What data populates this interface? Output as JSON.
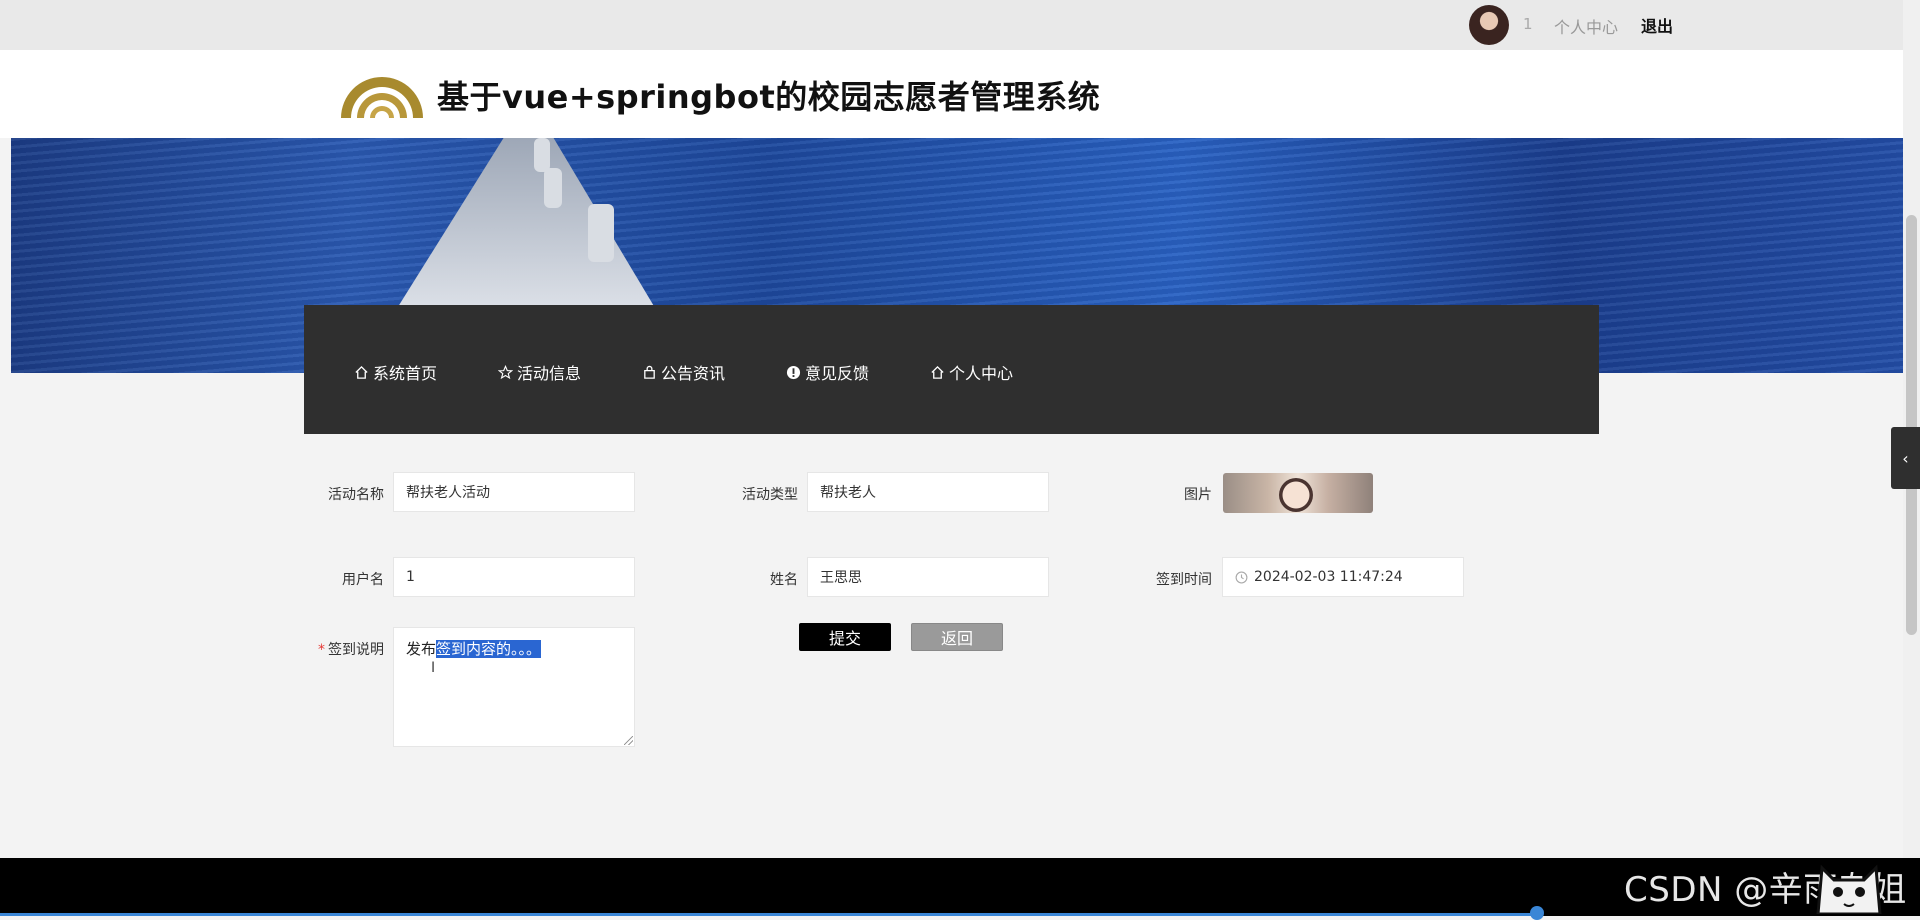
{
  "topbar": {
    "user_id": "1",
    "personal_center": "个人中心",
    "logout": "退出"
  },
  "header": {
    "title": "基于vue+springbot的校园志愿者管理系统",
    "logo_icon": "arch-logo-icon"
  },
  "nav": {
    "items": [
      {
        "label": "系统首页",
        "icon": "home-icon"
      },
      {
        "label": "活动信息",
        "icon": "star-icon"
      },
      {
        "label": "公告资讯",
        "icon": "bag-icon"
      },
      {
        "label": "意见反馈",
        "icon": "warning-icon"
      },
      {
        "label": "个人中心",
        "icon": "home-icon"
      }
    ]
  },
  "form": {
    "activity_name": {
      "label": "活动名称",
      "value": "帮扶老人活动"
    },
    "activity_type": {
      "label": "活动类型",
      "value": "帮扶老人"
    },
    "picture": {
      "label": "图片"
    },
    "username": {
      "label": "用户名",
      "value": "1"
    },
    "name": {
      "label": "姓名",
      "value": "王思思"
    },
    "checkin_time": {
      "label": "签到时间",
      "value": "2024-02-03 11:47:24",
      "icon": "clock-icon"
    },
    "checkin_note": {
      "required_mark": "*",
      "label": "签到说明",
      "value_plain": "发布",
      "value_selected": "签到内容的。。。"
    }
  },
  "buttons": {
    "submit": "提交",
    "back": "返回"
  },
  "watermark": "CSDN @辛雨杂姐",
  "colors": {
    "nav_bg": "#2f2f2f",
    "submit_bg": "#000000",
    "back_bg": "#9a9a9a",
    "selection": "#2a66d2",
    "required": "#e53935"
  }
}
